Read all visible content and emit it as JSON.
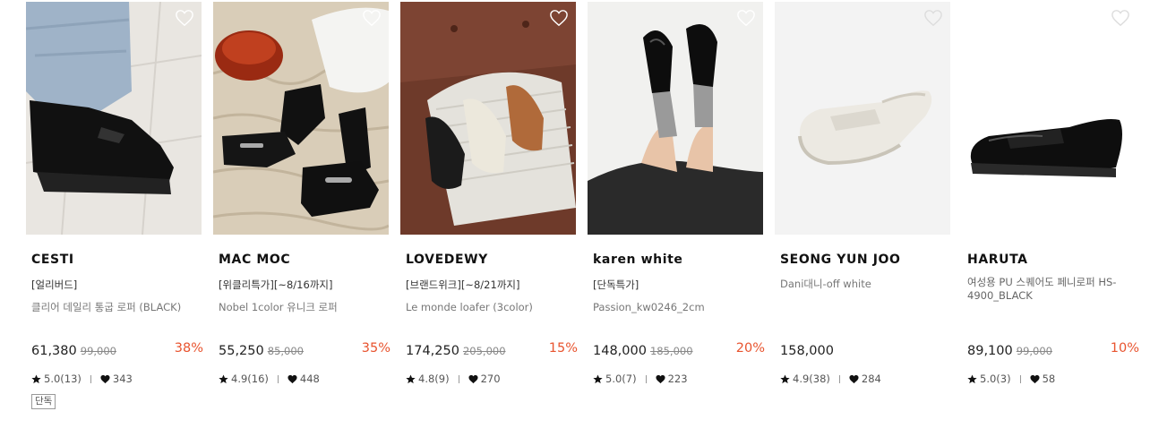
{
  "products": [
    {
      "brand": "CESTI",
      "promo": "[얼리버드]",
      "name": "클리어 데일리 통굽 로퍼 (BLACK)",
      "price": "61,380",
      "original_price": "99,000",
      "discount": "38%",
      "rating": "5.0(13)",
      "likes": "343",
      "badge": "단독"
    },
    {
      "brand": "MAC MOC",
      "promo": "[위클리특가][~8/16까지]",
      "name": "Nobel 1color 유니크 로퍼",
      "price": "55,250",
      "original_price": "85,000",
      "discount": "35%",
      "rating": "4.9(16)",
      "likes": "448"
    },
    {
      "brand": "LOVEDEWY",
      "promo": "[브랜드위크][~8/21까지]",
      "name": "Le monde loafer (3color)",
      "price": "174,250",
      "original_price": "205,000",
      "discount": "15%",
      "rating": "4.8(9)",
      "likes": "270"
    },
    {
      "brand": "karen white",
      "promo": "[단독특가]",
      "name": "Passion_kw0246_2cm",
      "price": "148,000",
      "original_price": "185,000",
      "discount": "20%",
      "rating": "5.0(7)",
      "likes": "223"
    },
    {
      "brand": "SEONG YUN JOO",
      "name": "Dani대니-off white",
      "price": "158,000",
      "rating": "4.9(38)",
      "likes": "284"
    },
    {
      "brand": "HARUTA",
      "name": "여성용 PU 스퀘어도 페니로퍼 HS-4900_BLACK",
      "price": "89,100",
      "original_price": "99,000",
      "discount": "10%",
      "rating": "5.0(3)",
      "likes": "58"
    }
  ],
  "icons": {
    "wishlist": "heart-outline-icon",
    "rating": "star-icon",
    "likes": "heart-icon"
  },
  "colors": {
    "discount": "#e8542f",
    "text": "#222222",
    "muted": "#777777"
  }
}
